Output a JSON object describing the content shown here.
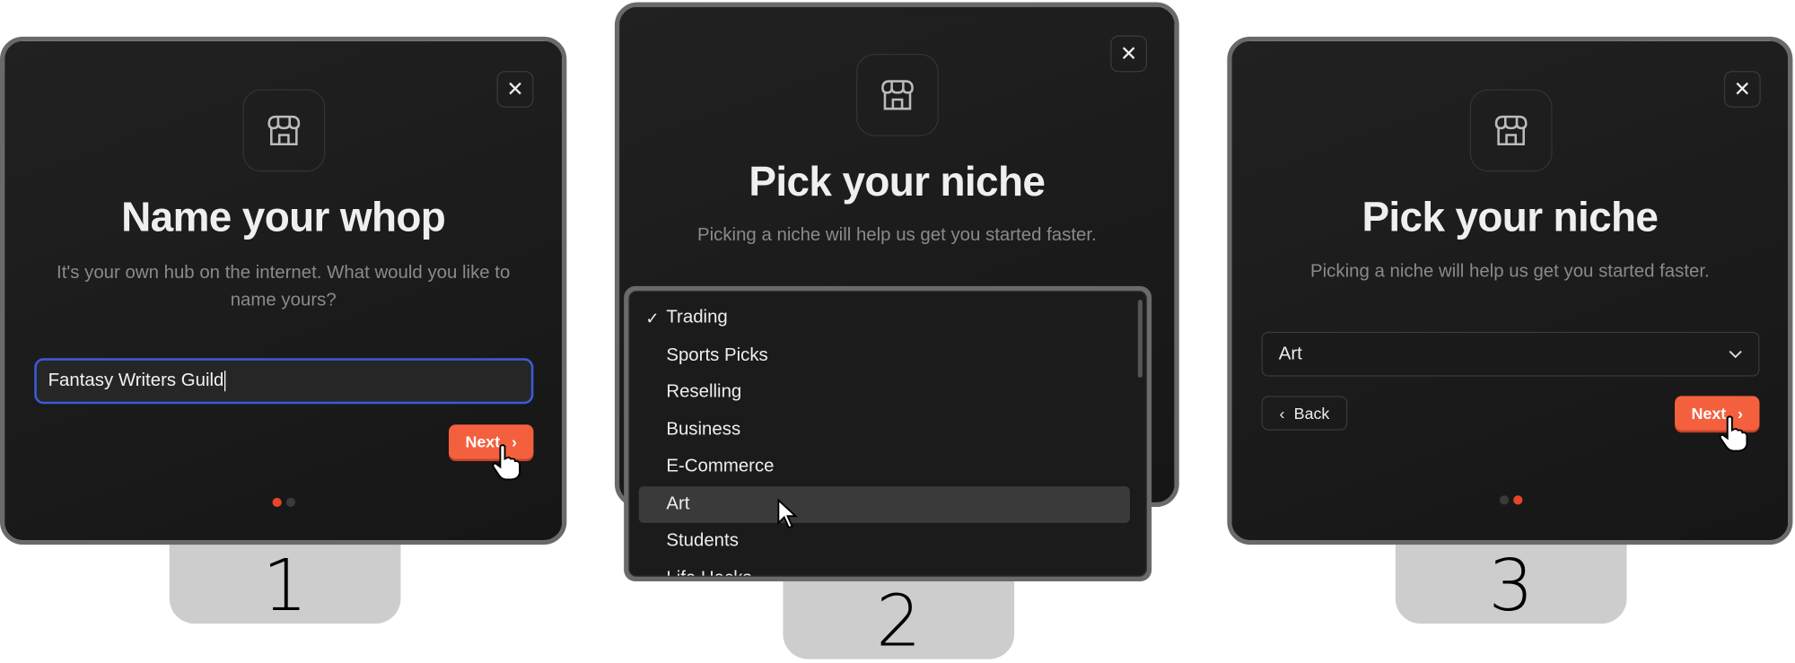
{
  "steps": [
    {
      "number": "1",
      "icon": "storefront-icon",
      "title": "Name your whop",
      "subtitle": "It's your own hub on the internet. What would you like to name yours?",
      "input_value": "Fantasy Writers Guild",
      "next_label": "Next",
      "active_dot": 1
    },
    {
      "number": "2",
      "icon": "storefront-icon",
      "title": "Pick your niche",
      "subtitle": "Picking a niche will help us get you started faster.",
      "options": [
        "Trading",
        "Sports Picks",
        "Reselling",
        "Business",
        "E-Commerce",
        "Art",
        "Students",
        "Life Hacks"
      ],
      "checked_option": "Trading",
      "hovered_option": "Art"
    },
    {
      "number": "3",
      "icon": "storefront-icon",
      "title": "Pick your niche",
      "subtitle": "Picking a niche will help us get you started faster.",
      "selected_value": "Art",
      "back_label": "Back",
      "next_label": "Next",
      "active_dot": 2
    }
  ],
  "colors": {
    "accent": "#f4603e",
    "focus": "#3b5bdb",
    "panel_bg": "#1b1b1b"
  }
}
